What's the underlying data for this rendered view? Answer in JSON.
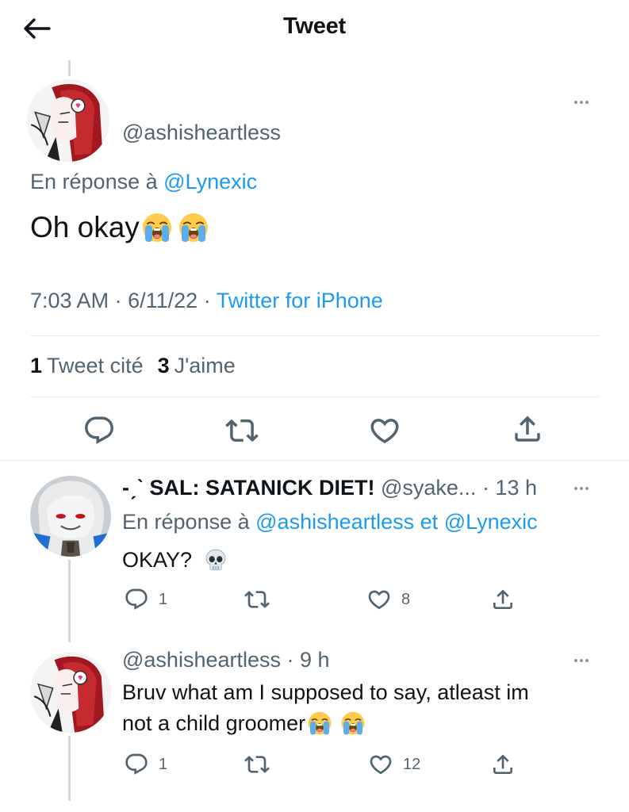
{
  "header": {
    "title": "Tweet"
  },
  "main_tweet": {
    "handle": "@ashisheartless",
    "reply_prefix": "En réponse à",
    "reply_mention": "@Lynexic",
    "text": "Oh okay",
    "emojis": [
      "loudly-crying-face",
      "loudly-crying-face"
    ],
    "time": "7:03 AM",
    "date": "6/11/22",
    "source": "Twitter for iPhone",
    "separator": "·",
    "quote_count": "1",
    "quote_label": "Tweet cité",
    "like_count": "3",
    "like_label": "J'aime"
  },
  "replies": [
    {
      "name": "-ˏˋ SAL: SATANICK DIET!",
      "handle": "@syake...",
      "time": "· 13 h",
      "reply_prefix": "En réponse à",
      "reply_mention1": "@ashisheartless",
      "reply_conj": "et",
      "reply_mention2": "@Lynexic",
      "text": "OKAY?",
      "emoji": "skull",
      "reply_count": "1",
      "retweet_count": "",
      "like_count": "8"
    },
    {
      "handle": "@ashisheartless",
      "time": "· 9 h",
      "text_line1": "Bruv what am I supposed to say, atleast im",
      "text_line2": "not a child groomer",
      "emojis": [
        "loudly-crying-face",
        "loudly-crying-face"
      ],
      "reply_count": "1",
      "retweet_count": "",
      "like_count": "12"
    }
  ],
  "colors": {
    "accent": "#1d9bf0",
    "text": "#0f1419",
    "secondary": "#536471",
    "divider": "#e6ecf0"
  }
}
